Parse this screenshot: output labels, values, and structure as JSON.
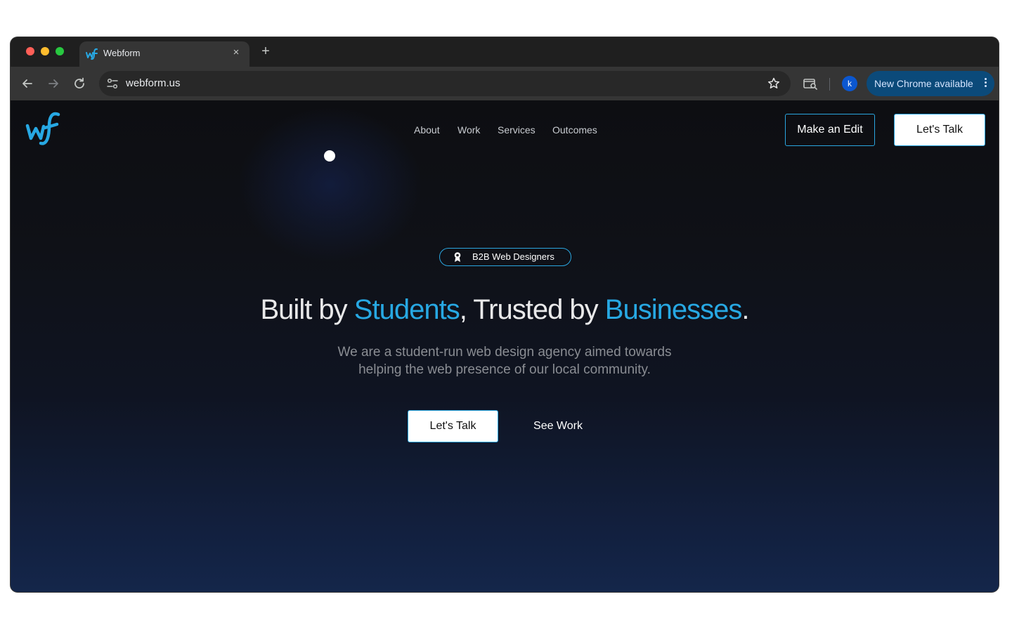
{
  "browser": {
    "tab": {
      "title": "Webform",
      "close_glyph": "×",
      "favicon": "webform-logo-icon"
    },
    "new_tab_glyph": "+",
    "url": "webform.us",
    "profile_initial": "k",
    "update_label": "New Chrome available"
  },
  "site": {
    "nav": [
      "About",
      "Work",
      "Services",
      "Outcomes"
    ],
    "header_buttons": {
      "edit": "Make an Edit",
      "talk": "Let's Talk"
    },
    "badge": {
      "label": "B2B Web Designers",
      "icon": "award-ribbon-icon"
    },
    "headline": {
      "part1": "Built by ",
      "accent1": "Students",
      "part2": ", Trusted by ",
      "accent2": "Businesses",
      "part3": "."
    },
    "subtext": {
      "line1": "We are a student-run web design agency aimed towards",
      "line2": "helping the web presence of our local community."
    },
    "cta": {
      "primary": "Let's Talk",
      "secondary": "See Work"
    }
  },
  "colors": {
    "accent": "#27a8e3",
    "page_bg_top": "#0d0e12",
    "page_bg_bottom": "#14264a",
    "update_pill": "#0b4a7a"
  }
}
